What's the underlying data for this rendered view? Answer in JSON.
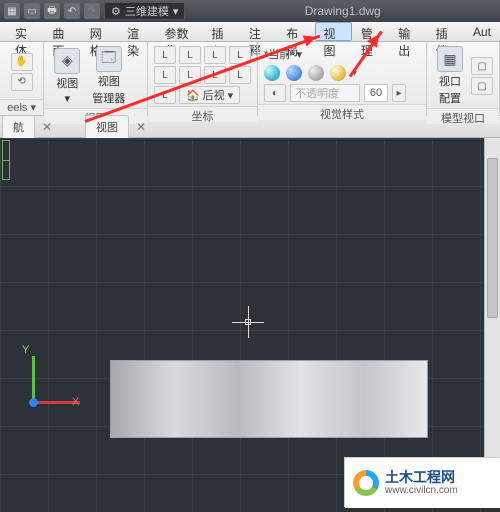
{
  "title": {
    "document": "Drawing1.dwg",
    "workspace": "三维建模"
  },
  "menu": {
    "items": [
      "实体",
      "曲面",
      "网格",
      "渲染",
      "参数化",
      "插入",
      "注释",
      "布局",
      "视图",
      "管理",
      "输出",
      "插件",
      "Aut"
    ],
    "active_index": 8
  },
  "ribbon": {
    "nav": {
      "label_eels": "eels",
      "label_eelsdrop": "▾",
      "pan_icon": "✋",
      "orbit_icon": "⟲"
    },
    "view_panel": {
      "title": "视图",
      "btn_view": "视图",
      "btn_view_drop": "▾",
      "btn_mgr_line1": "视图",
      "btn_mgr_line2": "管理器",
      "icon_mgr": "🗔"
    },
    "coord_panel": {
      "title": "坐标",
      "btn_back": "后视",
      "icon_back": "🏠"
    },
    "style_panel": {
      "title": "视觉样式",
      "dropdown_label": "*当前*",
      "opacity_placeholder": "不透明度",
      "opacity_value": "60"
    },
    "viewport_panel": {
      "title": "模型视口",
      "btn_vp1": "视口",
      "btn_vp2": "配置"
    }
  },
  "dock": {
    "nav_tab": "航",
    "view_tab": "视图"
  },
  "canvas": {
    "ucs": {
      "x": "X",
      "y": "Y"
    }
  },
  "watermark": {
    "name": "土木工程网",
    "url": "www.civilcn.com"
  }
}
